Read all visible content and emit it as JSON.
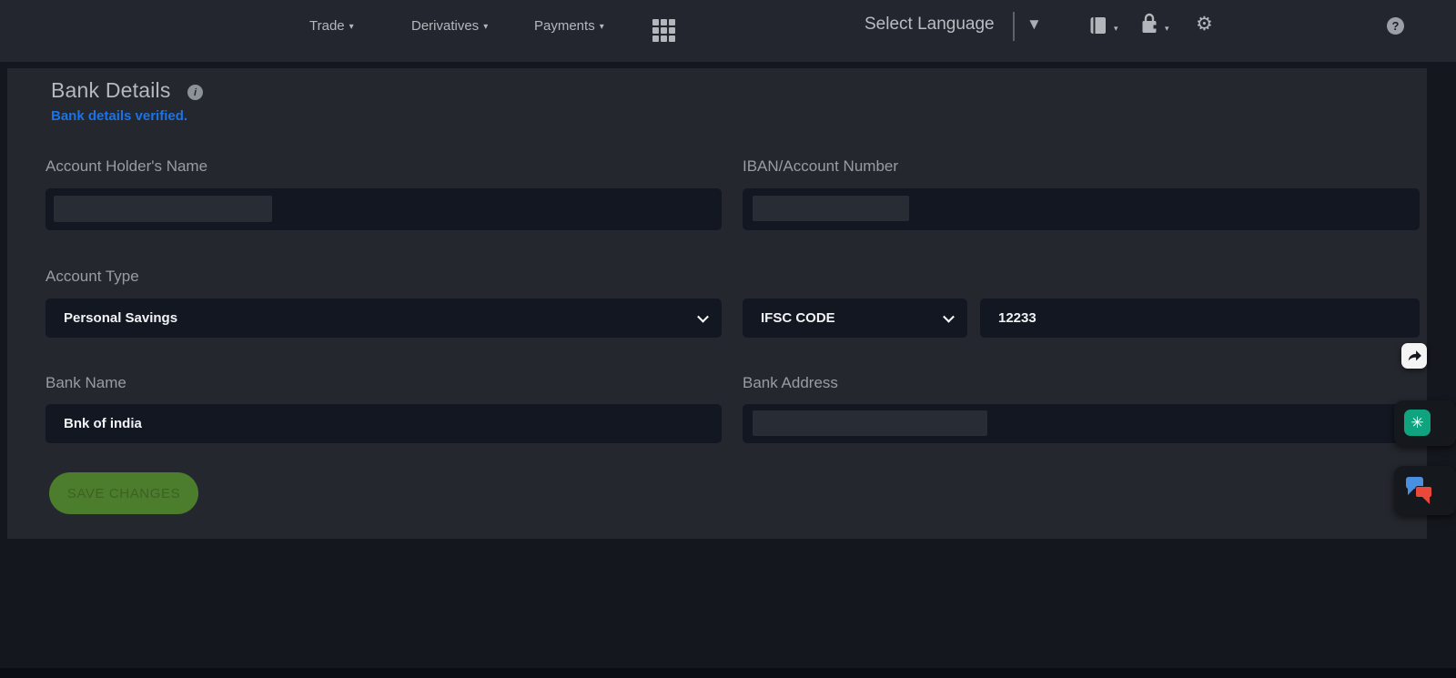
{
  "navbar": {
    "menus": [
      {
        "label": "Trade"
      },
      {
        "label": "Derivatives"
      },
      {
        "label": "Payments"
      }
    ],
    "language_label": "Select Language"
  },
  "header": {
    "title": "Bank Details",
    "verified_message": "Bank details verified."
  },
  "form": {
    "account_holder_label": "Account Holder's Name",
    "account_holder_value": "",
    "iban_label": "IBAN/Account Number",
    "iban_value": "",
    "account_type_label": "Account Type",
    "account_type_value": "Personal Savings",
    "ifsc_select_value": "IFSC CODE",
    "ifsc_code_value": "12233",
    "bank_name_label": "Bank Name",
    "bank_name_value": "Bnk of india",
    "bank_address_label": "Bank Address",
    "bank_address_value": "",
    "save_button_label": "SAVE CHANGES"
  },
  "icons": {
    "caret_down": "▾",
    "translate_triangle": "▼",
    "gear": "⚙",
    "help": "?",
    "info": "i",
    "chatgpt": "✳"
  },
  "colors": {
    "navbar_bg": "#23262e",
    "panel_bg": "#24272e",
    "input_bg": "#131721",
    "accent_blue": "#1a73e8",
    "button_green": "#4c7d2c",
    "chatgpt_green": "#10a37f",
    "bubble_blue": "#4a90e2",
    "bubble_red": "#e8493a"
  }
}
